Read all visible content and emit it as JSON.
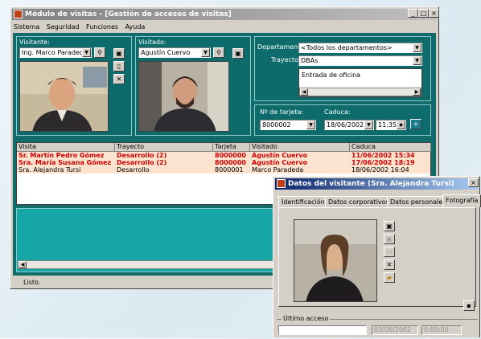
{
  "main_window": {
    "title": "Módulo de visitas - [Gestión de accesos de visitas]",
    "menu": [
      "Sistema",
      "Seguridad",
      "Funciones",
      "Ayuda"
    ],
    "window_buttons": {
      "minimize": "_",
      "maximize": "□",
      "close": "×"
    },
    "visitante": {
      "label": "Visitante:",
      "value": "Ing. Marco Paradeda"
    },
    "visitado": {
      "label": "Visitado:",
      "value": "Agustín Cuervo"
    },
    "departamento": {
      "label": "Departamento:",
      "value": "<Todos los departamentos>"
    },
    "trayecto": {
      "label": "Trayecto:",
      "value": "DBAs"
    },
    "notes": "Entrada de oficina",
    "tarjeta": {
      "label": "Nº de tarjeta:",
      "value": "8000002"
    },
    "caduca": {
      "label": "Caduca:",
      "date": "18/06/2002",
      "time": "11:35"
    },
    "table": {
      "columns": [
        "Visita",
        "Trayecto",
        "Tarjeta",
        "Visitado",
        "Caduca"
      ],
      "rows": [
        {
          "visita": "Sr. Martín Pedro Gómez",
          "trayecto": "Desarrollo (2)",
          "tarjeta": "8000000",
          "visitado": "Agustín Cuervo",
          "caduca": "11/06/2002 15:34",
          "highlight": true
        },
        {
          "visita": "Sra. María Susana Gómez",
          "trayecto": "Desarrollo (2)",
          "tarjeta": "8000000",
          "visitado": "Agustín Cuervo",
          "caduca": "17/06/2002 18:19",
          "highlight": true
        },
        {
          "visita": "Sra. Alejandra Tursi",
          "trayecto": "Desarrollo",
          "tarjeta": "8000001",
          "visitado": "Marco Paradeda",
          "caduca": "18/06/2002 16:04",
          "highlight": false
        }
      ]
    },
    "status": "Listo."
  },
  "dialog": {
    "title": "Datos del visitante (Sra. Alejandra Tursi)",
    "tabs": [
      "Identificación",
      "Datos corporativos",
      "Datos personales",
      "Fotografía"
    ],
    "active_tab": "Fotografía",
    "ultimo_acceso": {
      "label": "Último acceso",
      "date": "03/06/2002",
      "time": "0:00:00"
    }
  },
  "colors": {
    "accent": "#0a246a",
    "panel": "#116b6b",
    "highlight_text": "#d00000",
    "row_bg": "#fbe3cf"
  },
  "icons": [
    "binoculars-icon",
    "camera-icon",
    "new-document-icon",
    "delete-x-icon",
    "folder-icon",
    "save-disk-icon",
    "add-plus-icon"
  ]
}
